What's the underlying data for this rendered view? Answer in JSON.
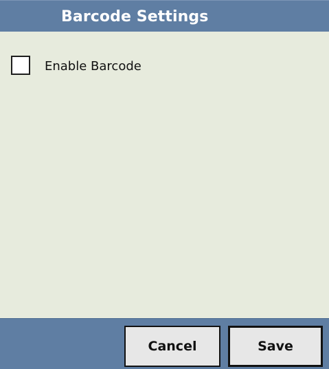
{
  "title_bar": {
    "title": "Barcode Settings"
  },
  "settings": {
    "enable_barcode": {
      "label": "Enable Barcode",
      "checked": false
    }
  },
  "footer": {
    "cancel_label": "Cancel",
    "save_label": "Save"
  },
  "colors": {
    "bar_background": "#5f7ea3",
    "content_background": "#e7ebdd",
    "button_background": "#e7e7e7"
  }
}
